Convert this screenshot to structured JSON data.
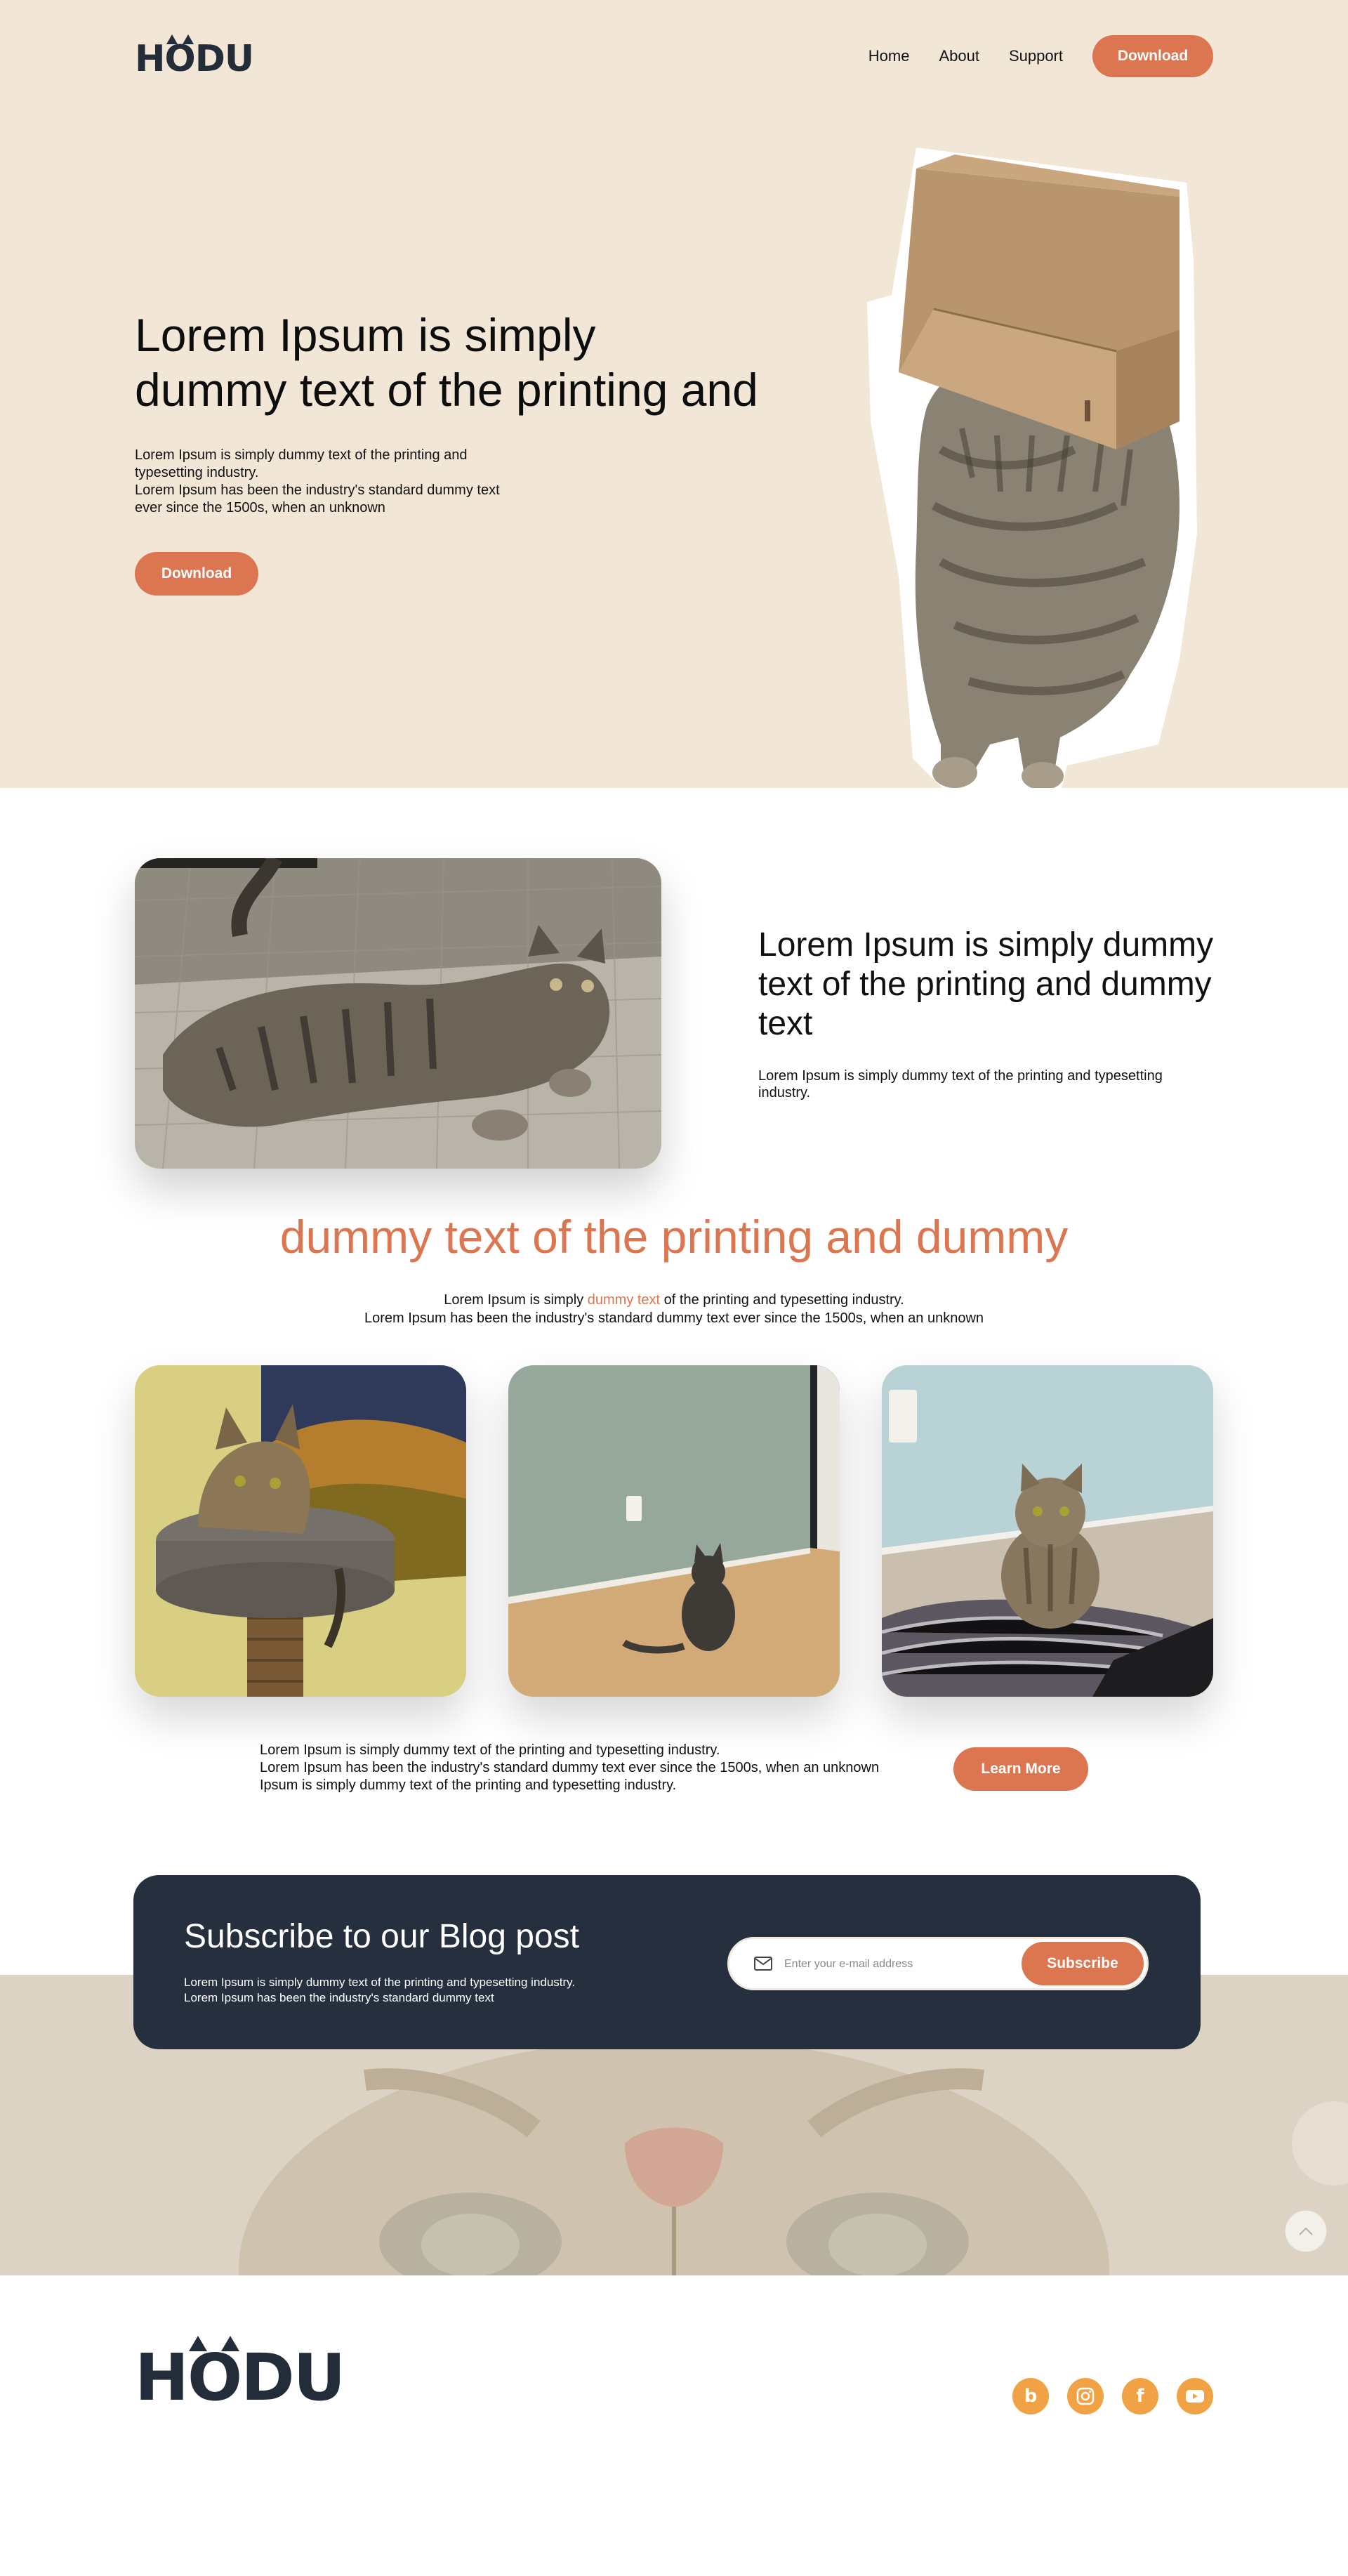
{
  "brand": {
    "name": "HODU"
  },
  "nav": {
    "links": [
      "Home",
      "About",
      "Support"
    ],
    "download_label": "Download"
  },
  "hero": {
    "title_line1": "Lorem Ipsum is simply",
    "title_line2": "dummy text of the printing and",
    "text_lines": [
      "Lorem Ipsum is simply dummy text of the printing and",
      "typesetting industry.",
      "Lorem Ipsum has been the industry's standard dummy text",
      "ever since the 1500s, when an unknown"
    ],
    "button_label": "Download"
  },
  "feature": {
    "title": "Lorem Ipsum is simply dummy text of the printing and dummy text",
    "text": "Lorem Ipsum is simply dummy text of the printing and typesetting industry."
  },
  "gallery": {
    "title": "dummy text of the printing and dummy",
    "intro_before": "Lorem Ipsum is simply ",
    "intro_highlight": "dummy text",
    "intro_after": " of the printing and typesetting industry.",
    "intro_line2": "Lorem Ipsum has been the industry's standard dummy text ever since the 1500s, when an unknown"
  },
  "cta": {
    "lines": [
      "Lorem Ipsum is simply dummy text of the printing and typesetting industry.",
      "Lorem Ipsum has been the industry's standard dummy text ever since the 1500s, when an unknown",
      "Ipsum is simply dummy text of the printing and typesetting industry."
    ],
    "button_label": "Learn More"
  },
  "subscribe": {
    "title": "Subscribe to our Blog post",
    "text_lines": [
      "Lorem Ipsum is simply dummy text of the printing and typesetting industry.",
      "Lorem Ipsum has been the industry's standard dummy text"
    ],
    "email_placeholder": "Enter your e-mail address",
    "button_label": "Subscribe"
  },
  "footer": {
    "socials": [
      {
        "icon": "blog-icon",
        "glyph": "b"
      },
      {
        "icon": "instagram-icon",
        "glyph": ""
      },
      {
        "icon": "facebook-icon",
        "glyph": "f"
      },
      {
        "icon": "youtube-icon",
        "glyph": ""
      }
    ]
  },
  "colors": {
    "accent": "#dc7651",
    "hero_bg": "#f2e7d6",
    "dark": "#252f3d",
    "social": "#f0a245"
  }
}
